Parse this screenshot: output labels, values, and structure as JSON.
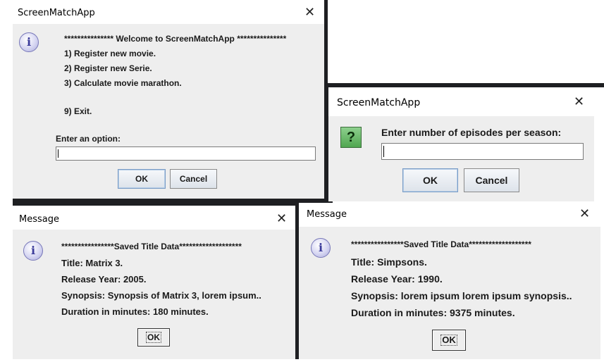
{
  "welcome_dialog": {
    "title": "ScreenMatchApp",
    "close_glyph": "✕",
    "icon": "information-icon",
    "icon_glyph": "i",
    "header": "*************** Welcome to ScreenMatchApp ***************",
    "menu": [
      "1) Register new movie.",
      "2) Register new Serie.",
      "3) Calculate movie marathon.",
      "9) Exit."
    ],
    "prompt": "Enter an option:",
    "input_value": "",
    "ok_label": "OK",
    "cancel_label": "Cancel"
  },
  "episodes_dialog": {
    "title": "ScreenMatchApp",
    "close_glyph": "✕",
    "icon": "question-icon",
    "icon_glyph": "?",
    "prompt": "Enter number of episodes per season:",
    "input_value": "",
    "ok_label": "OK",
    "cancel_label": "Cancel"
  },
  "movie_message": {
    "title": "Message",
    "close_glyph": "✕",
    "icon": "information-icon",
    "icon_glyph": "i",
    "header": "****************Saved Title Data*******************",
    "lines": [
      "Title: Matrix 3.",
      "Release Year: 2005.",
      "Synopsis: Synopsis of Matrix 3, lorem ipsum..",
      "Duration in minutes: 180 minutes."
    ],
    "ok_label": "OK"
  },
  "serie_message": {
    "title": "Message",
    "close_glyph": "✕",
    "icon": "information-icon",
    "icon_glyph": "i",
    "header": "****************Saved Title Data*******************",
    "lines": [
      "Title: Simpsons.",
      "Release Year: 1990.",
      "Synopsis: lorem ipsum lorem ipsum synopsis..",
      "Duration in minutes: 9375 minutes."
    ],
    "ok_label": "OK"
  }
}
